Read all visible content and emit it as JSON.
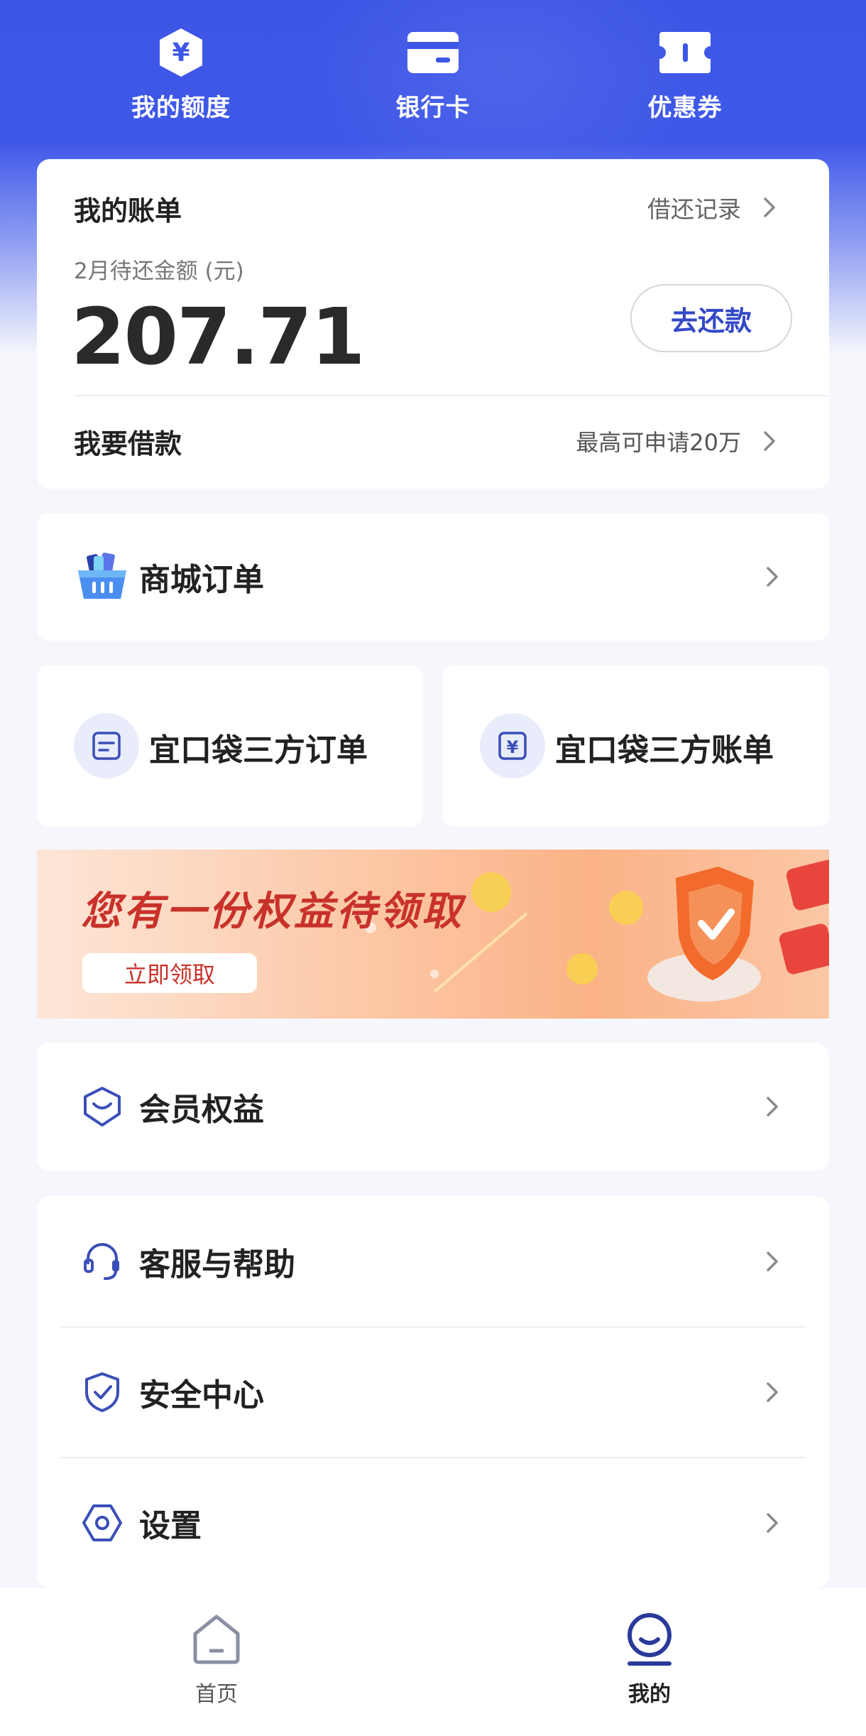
{
  "quick_nav": [
    {
      "label": "我的额度",
      "icon": "yuan-hexagon-icon"
    },
    {
      "label": "银行卡",
      "icon": "bank-card-icon"
    },
    {
      "label": "优惠券",
      "icon": "coupon-icon"
    }
  ],
  "bill": {
    "title": "我的账单",
    "record_label": "借还记录",
    "subtitle": "2月待还金额 (元)",
    "amount": "207.71",
    "repay_button": "去还款",
    "borrow_label": "我要借款",
    "borrow_note": "最高可申请20万"
  },
  "mall_order": {
    "label": "商城订单",
    "icon": "shopping-basket-icon"
  },
  "third_party": [
    {
      "label": "宜口袋三方订单",
      "icon": "order-doc-icon"
    },
    {
      "label": "宜口袋三方账单",
      "icon": "yuan-bill-icon"
    }
  ],
  "banner": {
    "title": "您有一份权益待领取",
    "button": "立即领取"
  },
  "member": {
    "label": "会员权益",
    "icon": "member-badge-icon"
  },
  "menu": [
    {
      "label": "客服与帮助",
      "icon": "headset-icon"
    },
    {
      "label": "安全中心",
      "icon": "shield-check-icon"
    },
    {
      "label": "设置",
      "icon": "settings-hexagon-icon"
    }
  ],
  "tabbar": [
    {
      "label": "首页",
      "icon": "home-icon",
      "active": false
    },
    {
      "label": "我的",
      "icon": "profile-icon",
      "active": true
    }
  ],
  "colors": {
    "primary": "#3d56e6",
    "accent_text": "#3348c7",
    "banner_red": "#c8322a",
    "icon_blue": "#3a4fb8"
  }
}
